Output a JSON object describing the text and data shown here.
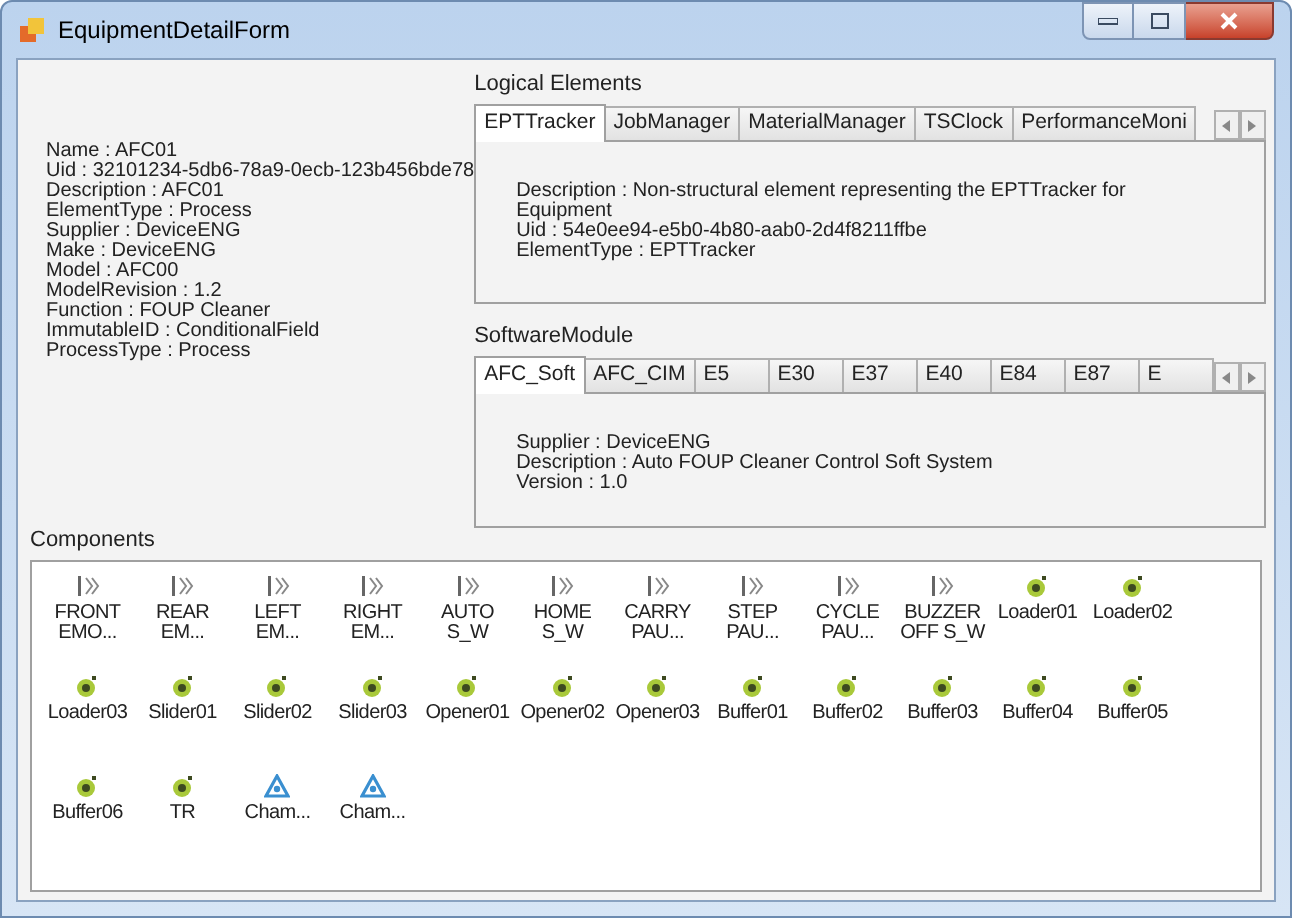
{
  "window": {
    "title": "EquipmentDetailForm"
  },
  "properties": [
    "Name : AFC01",
    "Uid : 32101234-5db6-78a9-0ecb-123b456bde78",
    "Description : AFC01",
    "ElementType : Process",
    "Supplier : DeviceENG",
    "Make : DeviceENG",
    "Model : AFC00",
    "ModelRevision : 1.2",
    "Function : FOUP Cleaner",
    "ImmutableID : ConditionalField",
    "ProcessType : Process"
  ],
  "logical_elements": {
    "label": "Logical Elements",
    "tabs": [
      {
        "label": "EPTTracker",
        "selected": true
      },
      {
        "label": "JobManager",
        "selected": false
      },
      {
        "label": "MaterialManager",
        "selected": false
      },
      {
        "label": "TSClock",
        "selected": false
      },
      {
        "label": "PerformanceMoni",
        "selected": false
      }
    ],
    "details": [
      "Description : Non-structural element representing the EPTTracker for Equipment",
      "Uid : 54e0ee94-e5b0-4b80-aab0-2d4f8211ffbe",
      "ElementType : EPTTracker"
    ]
  },
  "software_module": {
    "label": "SoftwareModule",
    "tabs": [
      {
        "label": "AFC_Soft",
        "selected": true
      },
      {
        "label": "AFC_CIM",
        "selected": false
      },
      {
        "label": "E5",
        "selected": false
      },
      {
        "label": "E30",
        "selected": false
      },
      {
        "label": "E37",
        "selected": false
      },
      {
        "label": "E40",
        "selected": false
      },
      {
        "label": "E84",
        "selected": false
      },
      {
        "label": "E87",
        "selected": false
      },
      {
        "label": "E",
        "selected": false
      }
    ],
    "details": [
      "Supplier : DeviceENG",
      "Description : Auto FOUP Cleaner Control Soft System",
      "Version : 1.0"
    ]
  },
  "components": {
    "label": "Components",
    "items": [
      {
        "label": "FRONT EMO...",
        "kind": "switch"
      },
      {
        "label": "REAR EM...",
        "kind": "switch"
      },
      {
        "label": "LEFT EM...",
        "kind": "switch"
      },
      {
        "label": "RIGHT EM...",
        "kind": "switch"
      },
      {
        "label": "AUTO S_W",
        "kind": "switch"
      },
      {
        "label": "HOME S_W",
        "kind": "switch"
      },
      {
        "label": "CARRY PAU...",
        "kind": "switch"
      },
      {
        "label": "STEP PAU...",
        "kind": "switch"
      },
      {
        "label": "CYCLE PAU...",
        "kind": "switch"
      },
      {
        "label": "BUZZER OFF S_W",
        "kind": "switch"
      },
      {
        "label": "Loader01",
        "kind": "unit"
      },
      {
        "label": "Loader02",
        "kind": "unit"
      },
      {
        "label": "Loader03",
        "kind": "unit"
      },
      {
        "label": "Slider01",
        "kind": "unit"
      },
      {
        "label": "Slider02",
        "kind": "unit"
      },
      {
        "label": "Slider03",
        "kind": "unit"
      },
      {
        "label": "Opener01",
        "kind": "unit"
      },
      {
        "label": "Opener02",
        "kind": "unit"
      },
      {
        "label": "Opener03",
        "kind": "unit"
      },
      {
        "label": "Buffer01",
        "kind": "unit"
      },
      {
        "label": "Buffer02",
        "kind": "unit"
      },
      {
        "label": "Buffer03",
        "kind": "unit"
      },
      {
        "label": "Buffer04",
        "kind": "unit"
      },
      {
        "label": "Buffer05",
        "kind": "unit"
      },
      {
        "label": "Buffer06",
        "kind": "unit"
      },
      {
        "label": "TR",
        "kind": "unit"
      },
      {
        "label": "Cham...",
        "kind": "chamber"
      },
      {
        "label": "Cham...",
        "kind": "chamber"
      }
    ]
  }
}
